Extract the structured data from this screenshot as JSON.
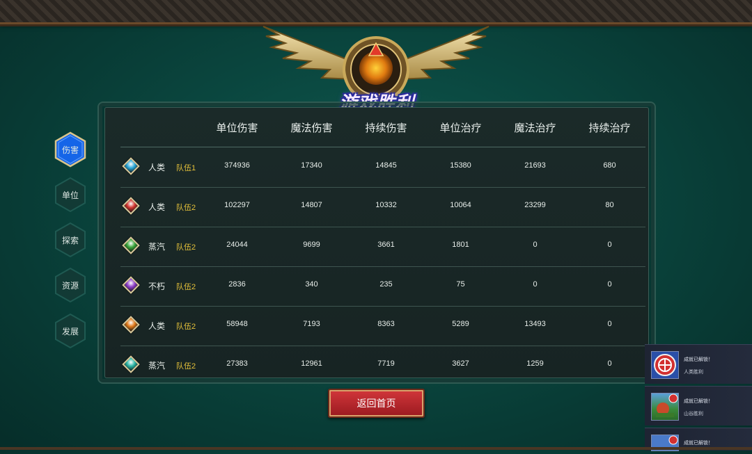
{
  "title": "游戏胜利",
  "side_tabs": [
    {
      "label": "伤害",
      "active": true
    },
    {
      "label": "单位",
      "active": false
    },
    {
      "label": "探索",
      "active": false
    },
    {
      "label": "资源",
      "active": false
    },
    {
      "label": "发展",
      "active": false
    }
  ],
  "table": {
    "headers": [
      "单位伤害",
      "魔法伤害",
      "持续伤害",
      "单位治疗",
      "魔法治疗",
      "持续治疗"
    ],
    "rows": [
      {
        "race": "人类",
        "team": "队伍1",
        "gem_color": "#2aa8d8",
        "values": [
          "374936",
          "17340",
          "14845",
          "15380",
          "21693",
          "680"
        ]
      },
      {
        "race": "人类",
        "team": "队伍2",
        "gem_color": "#d2352f",
        "values": [
          "102297",
          "14807",
          "10332",
          "10064",
          "23299",
          "80"
        ]
      },
      {
        "race": "蒸汽",
        "team": "队伍2",
        "gem_color": "#3aa63a",
        "values": [
          "24044",
          "9699",
          "3661",
          "1801",
          "0",
          "0"
        ]
      },
      {
        "race": "不朽",
        "team": "队伍2",
        "gem_color": "#8e3ec8",
        "values": [
          "2836",
          "340",
          "235",
          "75",
          "0",
          "0"
        ]
      },
      {
        "race": "人类",
        "team": "队伍2",
        "gem_color": "#e07a1a",
        "values": [
          "58948",
          "7193",
          "8363",
          "5289",
          "13493",
          "0"
        ]
      },
      {
        "race": "蒸汽",
        "team": "队伍2",
        "gem_color": "#2ab5a5",
        "values": [
          "27383",
          "12961",
          "7719",
          "3627",
          "1259",
          "0"
        ]
      }
    ]
  },
  "return_button": "返回首页",
  "notifications": [
    {
      "title": "成就已解锁！",
      "name": "人类胜利",
      "icon": "red-emblem-icon"
    },
    {
      "title": "成就已解锁！",
      "name": "山谷胜利",
      "icon": "valley-scene-icon"
    },
    {
      "title": "成就已解锁！",
      "name": "",
      "icon": "achievement-icon"
    }
  ],
  "colors": {
    "background": "#0b4a42",
    "team_label": "#e6c23a",
    "active_tab": "#1f6ff0",
    "button": "#c02a30"
  }
}
